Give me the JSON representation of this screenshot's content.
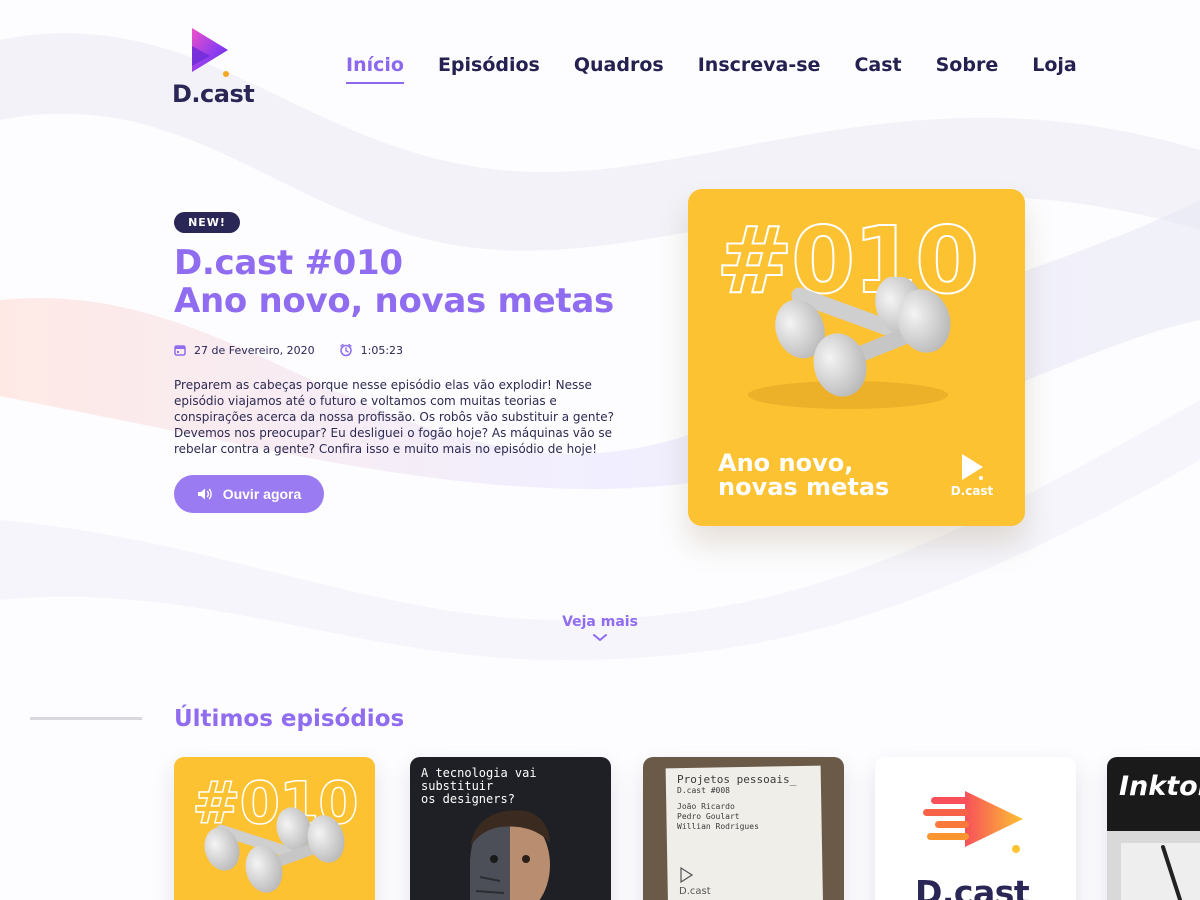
{
  "brand": {
    "name": "D.cast"
  },
  "nav": {
    "items": [
      {
        "label": "Início",
        "active": true
      },
      {
        "label": "Episódios"
      },
      {
        "label": "Quadros"
      },
      {
        "label": "Inscreva-se"
      },
      {
        "label": "Cast"
      },
      {
        "label": "Sobre"
      },
      {
        "label": "Loja"
      }
    ]
  },
  "hero": {
    "badge": "NEW!",
    "title_line1": "D.cast #010",
    "title_line2": "Ano novo, novas metas",
    "date": "27 de Fevereiro, 2020",
    "duration": "1:05:23",
    "description": "Preparem as cabeças porque nesse episódio elas vão explodir! Nesse episódio viajamos até o futuro e voltamos com muitas teorias e conspirações acerca da nossa profissão. Os robôs vão substituir a gente? Devemos nos preocupar? Eu desliguei o fogão hoje? As máquinas vão se rebelar contra a gente? Confira isso e muito mais no episódio de hoje!",
    "listen_button": "Ouvir agora",
    "cover": {
      "number": "#010",
      "title_line1": "Ano novo,",
      "title_line2": "novas metas",
      "logo_text": "D.cast",
      "bg_color": "#fcc232"
    }
  },
  "see_more": "Veja mais",
  "latest": {
    "title": "Últimos episódios",
    "cards": [
      {
        "number": "#010"
      },
      {
        "line1": "A tecnologia vai",
        "line2": "substituir",
        "line3": "os designers?"
      },
      {
        "title": "Projetos pessoais_",
        "subtitle": "D.cast #008",
        "names": [
          "João Ricardo",
          "Pedro Goulart",
          "Willian Rodrigues"
        ],
        "logo_text": "D.cast"
      },
      {
        "logo_text": "D.cast"
      },
      {
        "text": "Inktob"
      }
    ]
  },
  "colors": {
    "accent": "#8f6cf0",
    "dark": "#2a2656",
    "yellow": "#fcc232"
  }
}
